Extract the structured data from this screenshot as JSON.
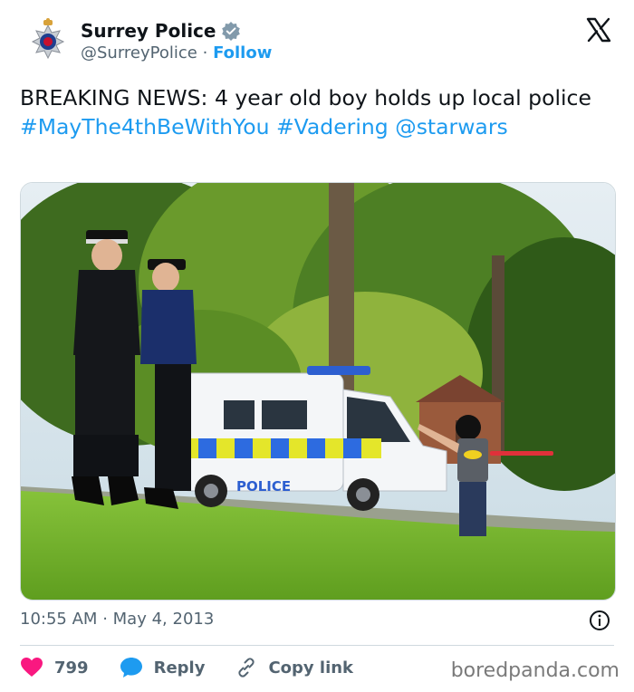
{
  "account": {
    "name": "Surrey Police",
    "handle": "@SurreyPolice",
    "separator": "·",
    "follow_label": "Follow"
  },
  "post": {
    "text_plain": "BREAKING NEWS: 4 year old boy holds up local police",
    "hashtag_1": "#MayThe4thBeWithYou",
    "hashtag_2": "#Vadering",
    "mention": "@starwars"
  },
  "photo": {
    "van_text": "POLICE"
  },
  "meta": {
    "time": "10:55 AM",
    "separator": "·",
    "date": "May 4, 2013"
  },
  "actions": {
    "likes": "799",
    "reply_label": "Reply",
    "copy_link_label": "Copy link"
  },
  "watermark": "boredpanda.com",
  "colors": {
    "link": "#1d9bf0",
    "like": "#f91880",
    "text": "#0f1419",
    "muted": "#536471"
  }
}
